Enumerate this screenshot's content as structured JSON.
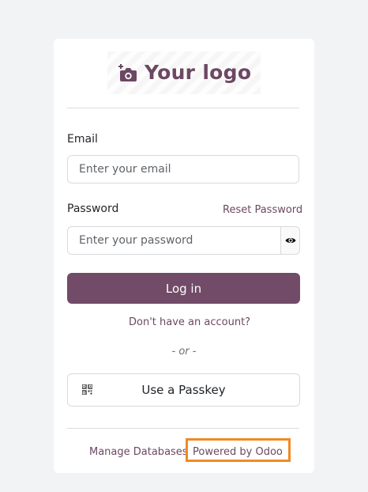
{
  "logo": {
    "text": "Your logo",
    "icon": "camera-plus-icon"
  },
  "form": {
    "email_label": "Email",
    "email_placeholder": "Enter your email",
    "password_label": "Password",
    "reset_password_label": "Reset Password",
    "password_placeholder": "Enter your password",
    "show_password_icon": "eye-icon",
    "login_label": "Log in",
    "signup_label": "Don't have an account?",
    "or_label": "- or -",
    "passkey_label": "Use a Passkey",
    "passkey_icon": "qr-code-icon"
  },
  "footer": {
    "manage_databases_label": "Manage Databases",
    "powered_by_label": "Powered by Odoo",
    "highlight_color": "#f08a24"
  },
  "colors": {
    "brand": "#714b67",
    "background": "#f2f3f5"
  }
}
